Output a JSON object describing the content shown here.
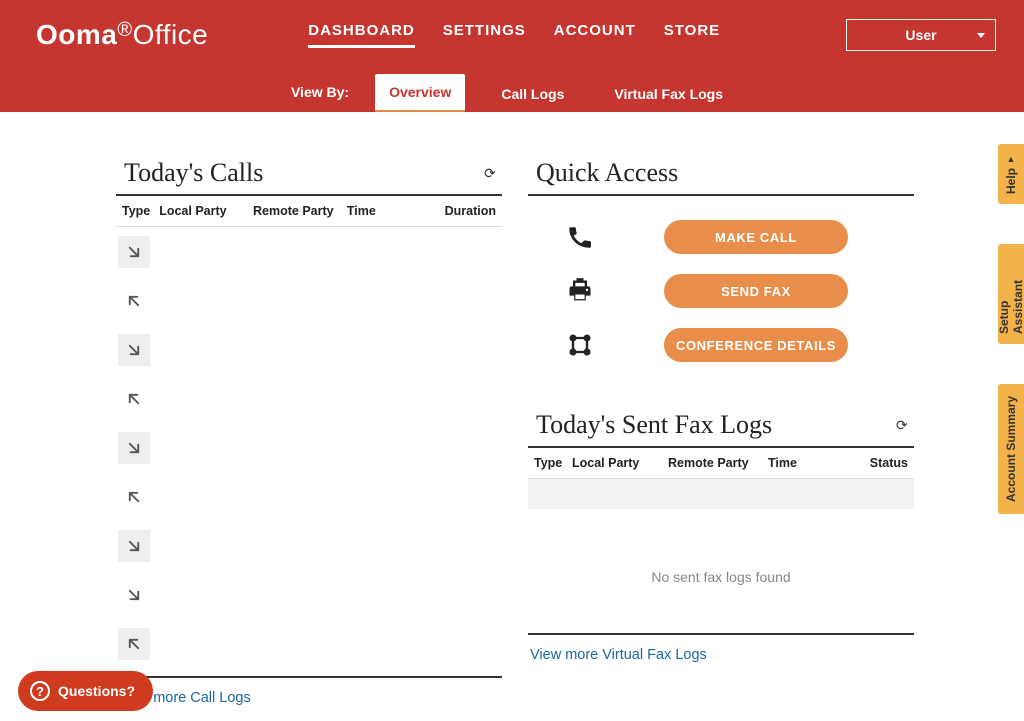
{
  "brand": {
    "bold": "Ooma",
    "light": "Office"
  },
  "nav": {
    "items": [
      {
        "label": "DASHBOARD",
        "active": true
      },
      {
        "label": "SETTINGS",
        "active": false
      },
      {
        "label": "ACCOUNT",
        "active": false
      },
      {
        "label": "STORE",
        "active": false
      }
    ]
  },
  "user_menu": {
    "label": "User"
  },
  "view_by_label": "View By:",
  "subtabs": [
    {
      "label": "Overview",
      "active": true
    },
    {
      "label": "Call Logs",
      "active": false
    },
    {
      "label": "Virtual Fax Logs",
      "active": false
    }
  ],
  "calls": {
    "title": "Today's Calls",
    "columns": [
      "Type",
      "Local Party",
      "Remote Party",
      "Time",
      "Duration"
    ],
    "rows": [
      {
        "dir": "in"
      },
      {
        "dir": "out"
      },
      {
        "dir": "in"
      },
      {
        "dir": "out"
      },
      {
        "dir": "in"
      },
      {
        "dir": "out"
      },
      {
        "dir": "in"
      },
      {
        "dir": "in"
      },
      {
        "dir": "out"
      }
    ],
    "view_more": "View more Call Logs"
  },
  "quick_access": {
    "title": "Quick Access",
    "make_call": "MAKE CALL",
    "send_fax": "SEND FAX",
    "conference": "CONFERENCE DETAILS"
  },
  "fax": {
    "title": "Today's Sent Fax Logs",
    "columns": [
      "Type",
      "Local Party",
      "Remote Party",
      "Time",
      "Status"
    ],
    "empty_text": "No sent fax logs found",
    "view_more": "View more Virtual Fax Logs"
  },
  "side_tabs": {
    "help": "Help",
    "setup": "Setup Assistant",
    "summary": "Account Summary"
  },
  "questions_label": "Questions?"
}
